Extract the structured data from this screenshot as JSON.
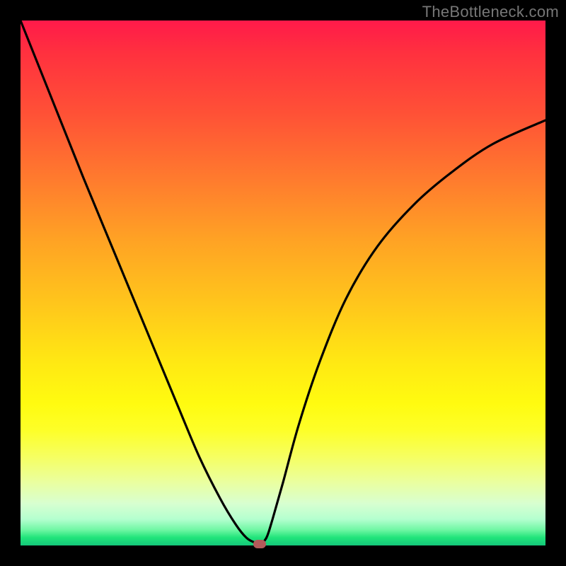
{
  "watermark": "TheBottleneck.com",
  "chart_data": {
    "type": "line",
    "title": "",
    "xlabel": "",
    "ylabel": "",
    "xlim": [
      0,
      100
    ],
    "ylim": [
      0,
      100
    ],
    "series": [
      {
        "name": "curve",
        "x": [
          0,
          6,
          12,
          18,
          24,
          30,
          34,
          38,
          41,
          43,
          44.5,
          45.5,
          46.2,
          47,
          48,
          50,
          53,
          57,
          62,
          68,
          75,
          82,
          90,
          100
        ],
        "y": [
          100,
          85,
          70,
          55.5,
          41,
          26.5,
          17,
          9,
          4,
          1.5,
          0.6,
          0.3,
          0.6,
          1.8,
          5,
          12,
          23,
          35,
          47,
          57,
          65,
          71,
          76.5,
          81
        ]
      }
    ],
    "min_point": {
      "x": 45.5,
      "y": 0.3
    }
  }
}
